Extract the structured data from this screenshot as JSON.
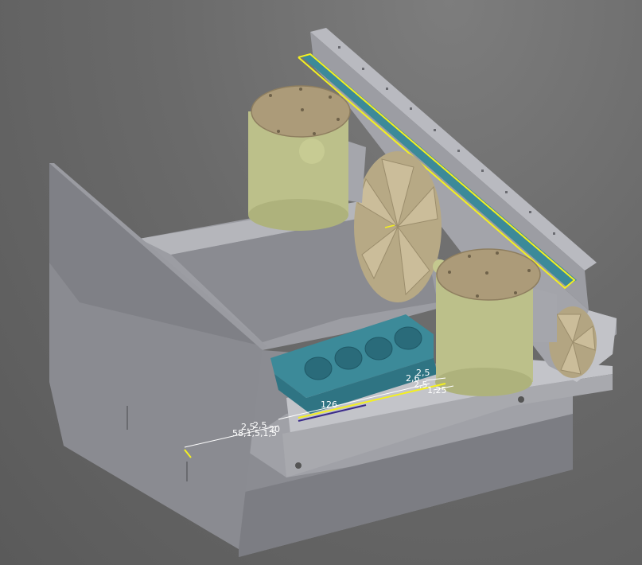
{
  "viewport": {
    "background": "#6a6a6a"
  },
  "colors": {
    "frame_gray": "#a7a8ae",
    "frame_dark": "#8c8d93",
    "frame_light": "#c3c4c9",
    "tank_green": "#bcc08a",
    "tank_lid": "#ac9b79",
    "fan_tan": "#c8b997",
    "block_teal": "#3c8a99",
    "highlight_yellow": "#f4f020",
    "dimension_white": "#ffffff"
  },
  "dimensions": {
    "d126": "126",
    "d25a": "2,5",
    "d25b": "2,5",
    "d25c": "2,5",
    "d26": "2,6",
    "d125": "1,25",
    "d20": "20",
    "d58": "58,1,5,1,5",
    "d25d": "2,5"
  },
  "components": {
    "tank_left": "filter-tank",
    "tank_right": "filter-tank",
    "fan_main": "radiator-fan",
    "fan_right": "radiator-fan",
    "engine_block": "engine-block",
    "top_rail": "mounting-rail",
    "side_panel": "side-panel"
  }
}
